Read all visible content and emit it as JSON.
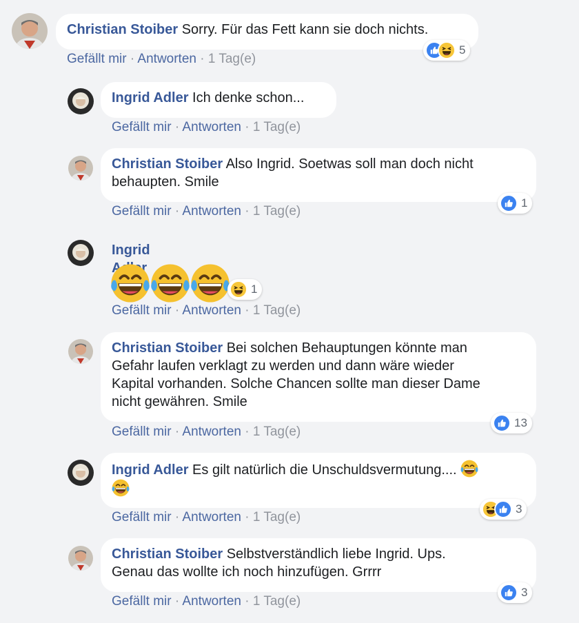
{
  "comments": [
    {
      "name": "Christian Stoiber",
      "text": "Sorry. Für das Fett kann sie doch nichts.",
      "like": "Gefällt mir",
      "reply": "Antworten",
      "time": "1 Tag(e)",
      "reactions": [
        "like",
        "haha"
      ],
      "count": "5"
    },
    {
      "name": "Ingrid Adler",
      "text": "Ich denke schon...",
      "like": "Gefällt mir",
      "reply": "Antworten",
      "time": "1 Tag(e)"
    },
    {
      "name": "Christian Stoiber",
      "text": "Also Ingrid. Soetwas soll man doch nicht",
      "text2": "behaupten. Smile",
      "like": "Gefällt mir",
      "reply": "Antworten",
      "time": "1 Tag(e)",
      "reactions": [
        "like"
      ],
      "count": "1"
    },
    {
      "name": "Ingrid Adler",
      "emoji": [
        "laugh-cry-emoji",
        "laugh-cry-emoji",
        "laugh-cry-emoji"
      ],
      "like": "Gefällt mir",
      "reply": "Antworten",
      "time": "1 Tag(e)",
      "reactions": [
        "haha"
      ],
      "count": "1"
    },
    {
      "name": "Christian Stoiber",
      "text": "Bei solchen Behauptungen könnte man",
      "text2": "Gefahr laufen verklagt zu werden und dann wäre wieder",
      "text3": "Kapital vorhanden. Solche Chancen sollte man dieser Dame",
      "text4": "nicht gewähren. Smile",
      "like": "Gefällt mir",
      "reply": "Antworten",
      "time": "1 Tag(e)",
      "reactions": [
        "like"
      ],
      "count": "13"
    },
    {
      "name": "Ingrid Adler",
      "text": "Es gilt natürlich die Unschuldsvermutung....",
      "like": "Gefällt mir",
      "reply": "Antworten",
      "time": "1 Tag(e)",
      "reactions": [
        "haha",
        "like"
      ],
      "count": "3"
    },
    {
      "name": "Christian Stoiber",
      "text": "Selbstverständlich liebe Ingrid. Ups.",
      "text2": "Genau das wollte ich noch hinzufügen. Grrrr",
      "like": "Gefällt mir",
      "reply": "Antworten",
      "time": "1 Tag(e)",
      "reactions": [
        "like"
      ],
      "count": "3"
    }
  ],
  "separator": " · ",
  "colors": {
    "name": "#385898",
    "link": "#4b67a1",
    "meta": "#90949c",
    "like": "#3b82f0",
    "haha": "#f7c63a",
    "background": "#f2f3f5"
  }
}
